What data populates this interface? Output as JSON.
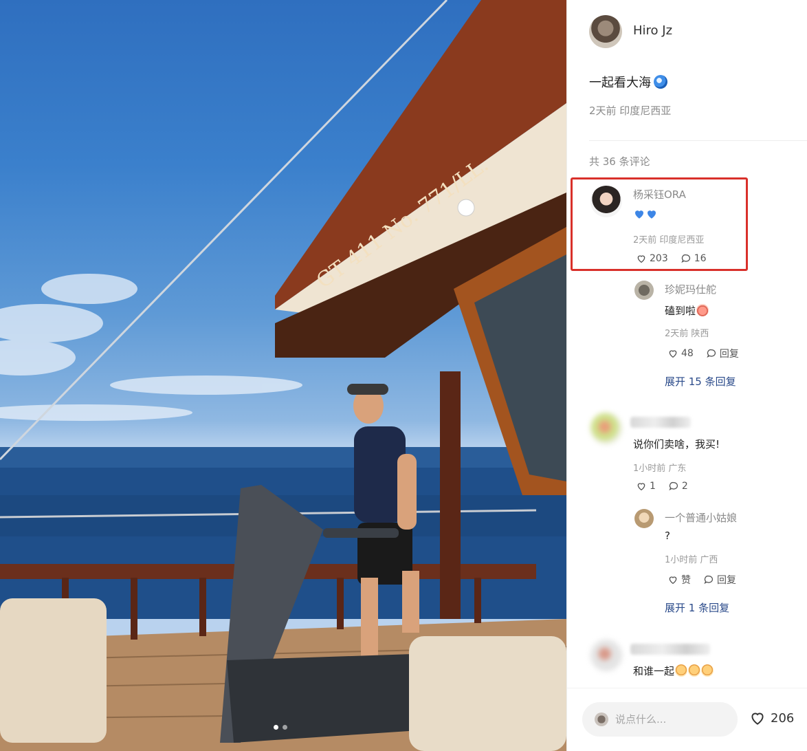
{
  "post": {
    "author_name": "Hiro Jz",
    "text": "一起看大海",
    "meta": "2天前 印度尼西亚",
    "image_count": 2,
    "image_index": 1
  },
  "comments_header": "共 36 条评论",
  "comments": [
    {
      "name": "杨采钰ORA",
      "meta": "2天前 印度尼西亚",
      "likes": "203",
      "replies": "16"
    },
    {
      "name": "",
      "text": "说你们卖啥，我买!",
      "meta": "1小时前 广东",
      "likes": "1",
      "replies": "2"
    },
    {
      "name": "",
      "text": "和谁一起"
    }
  ],
  "replies": [
    {
      "name": "珍妮玛仕舵",
      "text": "磕到啦",
      "meta": "2天前 陕西",
      "likes": "48",
      "reply_label": "回复",
      "expand": "展开 15 条回复"
    },
    {
      "name": "一个普通小姑娘",
      "text": "?",
      "meta": "1小时前 广西",
      "likes": "赞",
      "reply_label": "回复",
      "expand": "展开 1 条回复"
    }
  ],
  "bottom": {
    "input_placeholder": "说点什么...",
    "like_count": "206"
  },
  "colors": {
    "highlight": "#d9302a",
    "expand_link": "#2a4a8a"
  }
}
